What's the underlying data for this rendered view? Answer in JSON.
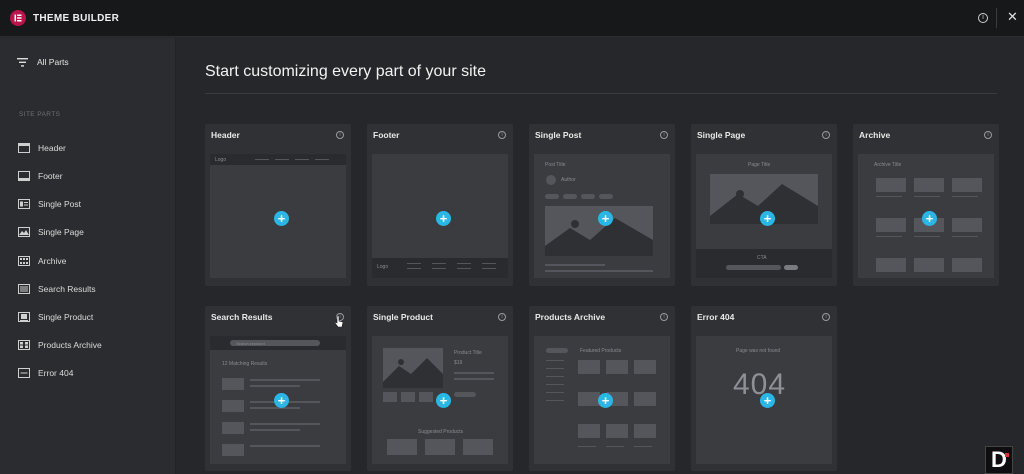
{
  "topbar": {
    "title": "THEME BUILDER",
    "info_icon": "info-icon",
    "close_icon": "close-icon"
  },
  "sidebar": {
    "all_parts": "All Parts",
    "section_label": "SITE PARTS",
    "items": [
      {
        "label": "Header",
        "icon": "header-icon"
      },
      {
        "label": "Footer",
        "icon": "footer-icon"
      },
      {
        "label": "Single Post",
        "icon": "single-post-icon"
      },
      {
        "label": "Single Page",
        "icon": "single-page-icon"
      },
      {
        "label": "Archive",
        "icon": "archive-icon"
      },
      {
        "label": "Search Results",
        "icon": "search-results-icon"
      },
      {
        "label": "Single Product",
        "icon": "single-product-icon"
      },
      {
        "label": "Products Archive",
        "icon": "products-archive-icon"
      },
      {
        "label": "Error 404",
        "icon": "error-404-icon"
      }
    ]
  },
  "main": {
    "headline": "Start customizing every part of your site",
    "cards": [
      {
        "title": "Header",
        "preview_text": [
          "Logo"
        ]
      },
      {
        "title": "Footer",
        "preview_text": [
          "Logo"
        ]
      },
      {
        "title": "Single Post",
        "preview_text": [
          "Post Title",
          "Author"
        ]
      },
      {
        "title": "Single Page",
        "preview_text": [
          "Page Title",
          "CTA"
        ]
      },
      {
        "title": "Archive",
        "preview_text": [
          "Archive Title"
        ]
      },
      {
        "title": "Search Results",
        "preview_text": [
          "Search keyword",
          "12 Matching Results"
        ]
      },
      {
        "title": "Single Product",
        "preview_text": [
          "Product Title",
          "$19",
          "Suggested Products"
        ]
      },
      {
        "title": "Products Archive",
        "preview_text": [
          "Featured Products"
        ]
      },
      {
        "title": "Error 404",
        "preview_text": [
          "Page was not found",
          "404"
        ]
      }
    ]
  },
  "colors": {
    "accent": "#2bb7e5",
    "brand": "#b8154a",
    "background": "#26272a",
    "sidebar": "#2b2c2f",
    "card": "#303134"
  }
}
